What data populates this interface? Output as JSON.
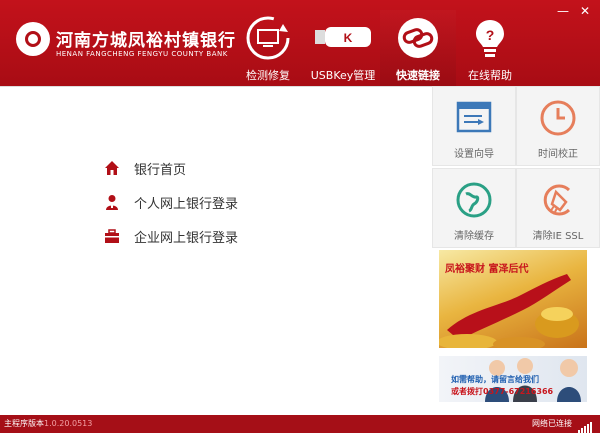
{
  "header": {
    "bank_name": "河南方城凤裕村镇银行",
    "bank_name_en": "HENAN FANGCHENG FENGYU COUNTY BANK",
    "nav": [
      {
        "label": "检测修复",
        "icon": "monitor-refresh-icon",
        "active": false
      },
      {
        "label": "USBKey管理",
        "icon": "usb-key-icon",
        "active": false
      },
      {
        "label": "快速链接",
        "icon": "link-icon",
        "active": true
      },
      {
        "label": "在线帮助",
        "icon": "lightbulb-icon",
        "active": false
      }
    ],
    "minimize_symbol": "—",
    "close_symbol": "✕"
  },
  "links": [
    {
      "label": "银行首页",
      "icon": "home-icon"
    },
    {
      "label": "个人网上银行登录",
      "icon": "person-icon"
    },
    {
      "label": "企业网上银行登录",
      "icon": "briefcase-icon"
    }
  ],
  "tools": [
    {
      "label": "设置向导",
      "icon": "setup-wizard-icon"
    },
    {
      "label": "时间校正",
      "icon": "clock-icon"
    },
    {
      "label": "清除缓存",
      "icon": "globe-icon"
    },
    {
      "label": "清除IE SSL",
      "icon": "broom-icon"
    }
  ],
  "ads": {
    "ad1_text": "凤裕聚财 富泽后代",
    "ad2_line1": "如需帮助，请留言给我们",
    "ad2_line2": "或者拨打0377-67216366"
  },
  "footer": {
    "version_label": "主程序版本",
    "version_number": "1.0.20.0513",
    "network_status": "网络已连接"
  },
  "colors": {
    "brand_red": "#b10f17",
    "accent_orange": "#e67e5b",
    "accent_blue": "#3c78b8",
    "accent_teal": "#2aa085"
  }
}
